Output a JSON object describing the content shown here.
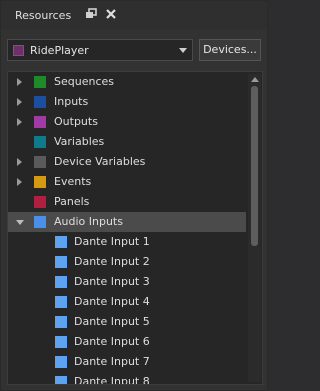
{
  "window": {
    "title": "Resources",
    "restore_icon": "restore-icon",
    "close_icon": "close-icon"
  },
  "toolbar": {
    "device_select": {
      "value": "RidePlayer",
      "color": "#6e2f6d"
    },
    "devices_button": "Devices..."
  },
  "tree": {
    "items": [
      {
        "label": "Sequences",
        "color": "#1e8a2a",
        "expander": "collapsed"
      },
      {
        "label": "Inputs",
        "color": "#1c4fa0",
        "expander": "collapsed"
      },
      {
        "label": "Outputs",
        "color": "#a03aa5",
        "expander": "collapsed"
      },
      {
        "label": "Variables",
        "color": "#0f7a8c",
        "expander": "none"
      },
      {
        "label": "Device Variables",
        "color": "#5a5a5a",
        "expander": "collapsed"
      },
      {
        "label": "Events",
        "color": "#d69a12",
        "expander": "collapsed"
      },
      {
        "label": "Panels",
        "color": "#b01e40",
        "expander": "none"
      },
      {
        "label": "Audio Inputs",
        "color": "#4a8fe8",
        "expander": "expanded",
        "selected": true
      },
      {
        "label": "Dante Input 1",
        "color": "#5ea2f2",
        "child": true
      },
      {
        "label": "Dante Input 2",
        "color": "#5ea2f2",
        "child": true
      },
      {
        "label": "Dante Input 3",
        "color": "#5ea2f2",
        "child": true
      },
      {
        "label": "Dante Input 4",
        "color": "#5ea2f2",
        "child": true
      },
      {
        "label": "Dante Input 5",
        "color": "#5ea2f2",
        "child": true
      },
      {
        "label": "Dante Input 6",
        "color": "#5ea2f2",
        "child": true
      },
      {
        "label": "Dante Input 7",
        "color": "#5ea2f2",
        "child": true
      },
      {
        "label": "Dante Input 8",
        "color": "#5ea2f2",
        "child": true
      }
    ]
  }
}
